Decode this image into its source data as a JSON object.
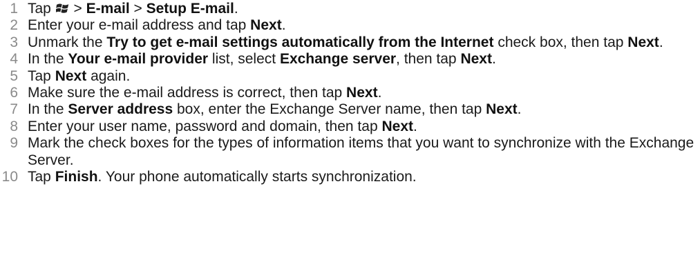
{
  "steps": [
    {
      "num": "1",
      "parts": [
        {
          "t": "Tap "
        },
        {
          "icon": "windows-start-icon"
        },
        {
          "t": " > "
        },
        {
          "t": "E-mail",
          "b": true
        },
        {
          "t": " > "
        },
        {
          "t": "Setup E-mail",
          "b": true
        },
        {
          "t": "."
        }
      ]
    },
    {
      "num": "2",
      "parts": [
        {
          "t": "Enter your e-mail address and tap "
        },
        {
          "t": "Next",
          "b": true
        },
        {
          "t": "."
        }
      ]
    },
    {
      "num": "3",
      "parts": [
        {
          "t": "Unmark the "
        },
        {
          "t": "Try to get e-mail settings automatically from the Internet",
          "b": true
        },
        {
          "t": " check box, then tap "
        },
        {
          "t": "Next",
          "b": true
        },
        {
          "t": "."
        }
      ]
    },
    {
      "num": "4",
      "parts": [
        {
          "t": "In the "
        },
        {
          "t": "Your e-mail provider",
          "b": true
        },
        {
          "t": " list, select "
        },
        {
          "t": "Exchange server",
          "b": true
        },
        {
          "t": ", then tap "
        },
        {
          "t": "Next",
          "b": true
        },
        {
          "t": "."
        }
      ]
    },
    {
      "num": "5",
      "parts": [
        {
          "t": "Tap "
        },
        {
          "t": "Next",
          "b": true
        },
        {
          "t": " again."
        }
      ]
    },
    {
      "num": "6",
      "parts": [
        {
          "t": "Make sure the e-mail address is correct, then tap "
        },
        {
          "t": "Next",
          "b": true
        },
        {
          "t": "."
        }
      ]
    },
    {
      "num": "7",
      "parts": [
        {
          "t": "In the "
        },
        {
          "t": "Server address",
          "b": true
        },
        {
          "t": " box, enter the Exchange Server name, then tap "
        },
        {
          "t": "Next",
          "b": true
        },
        {
          "t": "."
        }
      ]
    },
    {
      "num": "8",
      "parts": [
        {
          "t": "Enter your user name, password and domain, then tap "
        },
        {
          "t": "Next",
          "b": true
        },
        {
          "t": "."
        }
      ]
    },
    {
      "num": "9",
      "parts": [
        {
          "t": "Mark the check boxes for the types of information items that you want to synchronize with the Exchange Server."
        }
      ]
    },
    {
      "num": "10",
      "parts": [
        {
          "t": "Tap "
        },
        {
          "t": "Finish",
          "b": true
        },
        {
          "t": ". Your phone automatically starts synchronization."
        }
      ]
    }
  ]
}
